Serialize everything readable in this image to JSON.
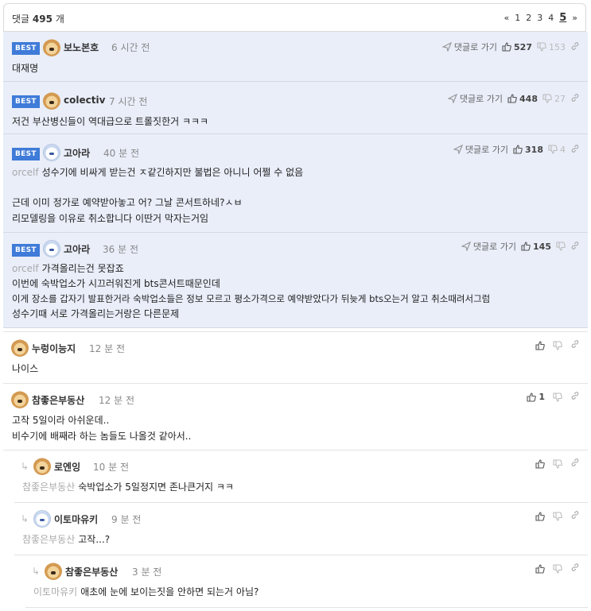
{
  "header": {
    "count_prefix": "댓글",
    "count": "495",
    "count_suffix": "개",
    "pager": {
      "prev": "«",
      "pages": [
        "1",
        "2",
        "3",
        "4"
      ],
      "current": "5",
      "next": "»"
    }
  },
  "labels": {
    "best": "BEST",
    "goto_reply": "댓글로 가기"
  },
  "comments": [
    {
      "nick": "보노본호",
      "time": "6 시간 전",
      "ref": "",
      "lines": [
        "대재명"
      ],
      "up": "527",
      "down": "153"
    },
    {
      "nick": "colectiv",
      "time": "7 시간 전",
      "ref": "",
      "lines": [
        "저건 부산병신들이 역대급으로 트롤짓한거 ㅋㅋㅋ"
      ],
      "up": "448",
      "down": "27"
    },
    {
      "nick": "고아라",
      "time": "40 분 전",
      "ref": "orcelf",
      "lines": [
        "성수기에 비싸게 받는건 ㅈ같긴하지만 불법은 아니니 어쩔 수 없음",
        "",
        "근데 이미 정가로 예약받아놓고 어? 그날 콘서트하네?ㅅㅂ",
        "리모델링을 이유로 취소합니다 이딴거 막자는거임"
      ],
      "up": "318",
      "down": "4"
    },
    {
      "nick": "고아라",
      "time": "36 분 전",
      "ref": "orcelf",
      "lines": [
        "가격올리는건 못잡죠",
        "이번에 숙박업소가 시끄러워진게 bts콘서트때문인데",
        "이게 장소를 갑자기 발표한거라 숙박업소들은 정보 모르고 평소가격으로 예약받았다가 뒤늦게 bts오는거 알고 취소때려서그럼",
        "성수기때 서로 가격올리는거랑은 다른문제"
      ],
      "up": "145",
      "down": ""
    },
    {
      "nick": "누렁이능지",
      "time": "12 분 전",
      "ref": "",
      "lines": [
        "나이스"
      ],
      "up": "",
      "down": ""
    },
    {
      "nick": "참좋은부동산",
      "time": "12 분 전",
      "ref": "",
      "lines": [
        "고작 5일이라 아쉬운데..",
        "비수기에 배째라 하는 놈들도 나올것 같아서.."
      ],
      "up": "1",
      "down": ""
    },
    {
      "nick": "로엔잉",
      "time": "10 분 전",
      "ref": "참좋은부동산",
      "lines": [
        "숙박업소가 5일정지면 존나큰거지 ㅋㅋ"
      ],
      "up": "",
      "down": ""
    },
    {
      "nick": "이토마유키",
      "time": "9 분 전",
      "ref": "참좋은부동산",
      "lines": [
        "고작...?"
      ],
      "up": "",
      "down": ""
    },
    {
      "nick": "참좋은부동산",
      "time": "3 분 전",
      "ref": "이토마유키",
      "lines": [
        "애초에 눈에 보이는짓을 안하면 되는거 아님?"
      ],
      "up": "",
      "down": ""
    }
  ]
}
